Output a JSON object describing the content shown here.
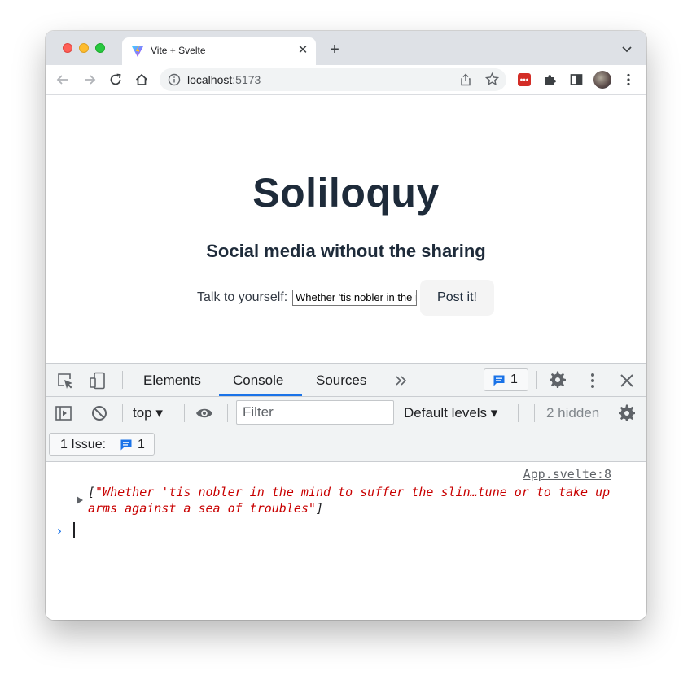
{
  "browser": {
    "tab_title": "Vite + Svelte",
    "url_host": "localhost",
    "url_port": ":5173"
  },
  "page": {
    "title": "Soliloquy",
    "subtitle": "Social media without the sharing",
    "input_label": "Talk to yourself:",
    "input_value": "Whether 'tis nobler in the mind to suffer the slings and arrows of outrageous fortune or to take up arms against a sea of troubles",
    "post_button": "Post it!"
  },
  "devtools": {
    "tabs": [
      "Elements",
      "Console",
      "Sources"
    ],
    "active_tab": "Console",
    "issues_badge_count": "1",
    "context": "top",
    "filter_placeholder": "Filter",
    "levels": "Default levels",
    "hidden": "2 hidden",
    "issues_label": "1 Issue:",
    "issues_count": "1",
    "console": {
      "source": "App.svelte:8",
      "open_bracket": "[",
      "string": "\"Whether 'tis nobler in the mind to suffer the slin…tune or to take up arms against a sea of troubles\"",
      "close_bracket": "]",
      "prompt": "›"
    }
  },
  "colors": {
    "accent": "#1a73e8",
    "console_string": "#c80000",
    "heading": "#1e2b3a"
  }
}
